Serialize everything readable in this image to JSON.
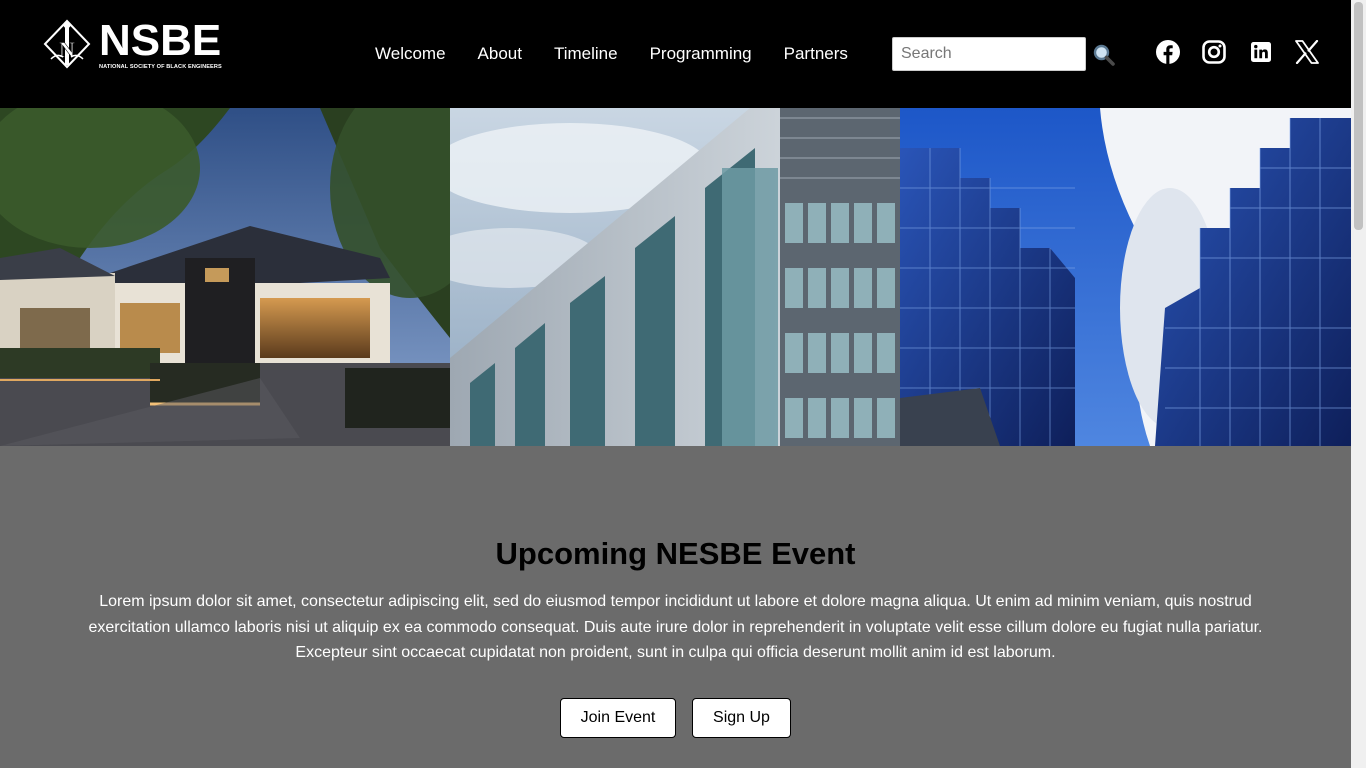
{
  "brand": {
    "name": "NSBE",
    "tagline": "NATIONAL SOCIETY OF BLACK ENGINEERS"
  },
  "nav": {
    "items": [
      {
        "label": "Welcome"
      },
      {
        "label": "About"
      },
      {
        "label": "Timeline"
      },
      {
        "label": "Programming"
      },
      {
        "label": "Partners"
      }
    ]
  },
  "search": {
    "placeholder": "Search",
    "value": "",
    "icon": "magnifier-icon"
  },
  "social": {
    "icons": [
      "facebook-icon",
      "instagram-icon",
      "linkedin-icon",
      "x-icon"
    ]
  },
  "hero": {
    "images": [
      "restaurant-courtyard-photo",
      "glass-office-building-photo",
      "blue-glass-skyscraper-photo"
    ]
  },
  "event": {
    "title": "Upcoming NESBE Event",
    "body": "Lorem ipsum dolor sit amet, consectetur adipiscing elit, sed do eiusmod tempor incididunt ut labore et dolore magna aliqua. Ut enim ad minim veniam, quis nostrud exercitation ullamco laboris nisi ut aliquip ex ea commodo consequat. Duis aute irure dolor in reprehenderit in voluptate velit esse cillum dolore eu fugiat nulla pariatur. Excepteur sint occaecat cupidatat non proident, sunt in culpa qui officia deserunt mollit anim id est laborum.",
    "join_label": "Join Event",
    "signup_label": "Sign Up"
  },
  "colors": {
    "header_bg": "#000000",
    "section_bg": "#6b6b6b",
    "text_light": "#ffffff"
  }
}
